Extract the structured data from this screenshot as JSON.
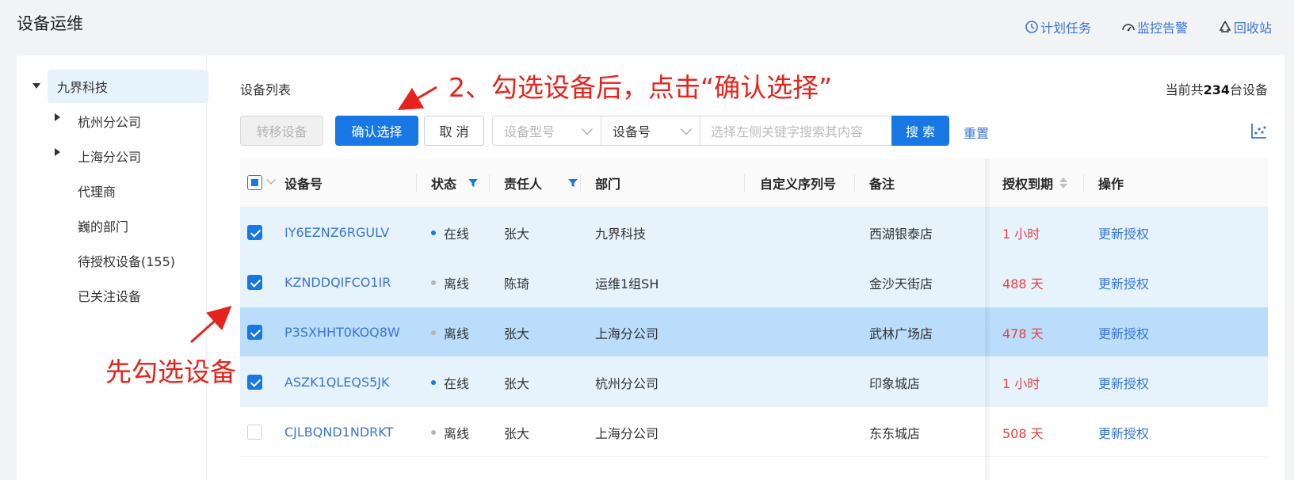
{
  "page": {
    "title": "设备运维"
  },
  "top_links": [
    {
      "label": "计划任务",
      "icon": "clock-icon"
    },
    {
      "label": "监控告警",
      "icon": "gauge-icon"
    },
    {
      "label": "回收站",
      "icon": "recycle-icon"
    }
  ],
  "tree": {
    "root": "九界科技",
    "items": [
      "杭州分公司",
      "上海分公司",
      "代理商",
      "巍的部门",
      "待授权设备(155)",
      "已关注设备"
    ]
  },
  "list": {
    "title": "设备列表",
    "count_prefix": "当前共",
    "count": "234",
    "count_suffix": "台设备"
  },
  "toolbar": {
    "transfer": "转移设备",
    "confirm": "确认选择",
    "cancel": "取 消",
    "model_placeholder": "设备型号",
    "field_select": "设备号",
    "search_placeholder": "选择左侧关键字搜索其内容",
    "search": "搜 索",
    "reset": "重置"
  },
  "columns": [
    "设备号",
    "状态",
    "责任人",
    "部门",
    "自定义序列号",
    "备注",
    "授权到期",
    "操作"
  ],
  "rows": [
    {
      "id": "IY6EZNZ6RGULV",
      "status": "在线",
      "owner": "张大",
      "dept": "九界科技",
      "serial": "",
      "note": "西湖银泰店",
      "expire": "1 小时",
      "action": "更新授权",
      "checked": true
    },
    {
      "id": "KZNDDQIFCO1IR",
      "status": "离线",
      "owner": "陈琦",
      "dept": "运维1组SH",
      "serial": "",
      "note": "金沙天街店",
      "expire": "488 天",
      "action": "更新授权",
      "checked": true
    },
    {
      "id": "P3SXHHT0KOQ8W",
      "status": "离线",
      "owner": "张大",
      "dept": "上海分公司",
      "serial": "",
      "note": "武林广场店",
      "expire": "478 天",
      "action": "更新授权",
      "checked": true
    },
    {
      "id": "ASZK1QLEQS5JK",
      "status": "在线",
      "owner": "张大",
      "dept": "杭州分公司",
      "serial": "",
      "note": "印象城店",
      "expire": "1 小时",
      "action": "更新授权",
      "checked": true
    },
    {
      "id": "CJLBQND1NDRKT",
      "status": "离线",
      "owner": "张大",
      "dept": "上海分公司",
      "serial": "",
      "note": "东东城店",
      "expire": "508 天",
      "action": "更新授权",
      "checked": false
    }
  ],
  "colors": {
    "primary": "#1677e5",
    "link": "#3a76d6",
    "danger": "#e8413e",
    "online": "#1677e5",
    "offline": "#b5b5b5",
    "annotation": "#e8231d"
  },
  "annotations": {
    "top": "2、勾选设备后，点击“确认选择”",
    "left": "先勾选设备"
  }
}
